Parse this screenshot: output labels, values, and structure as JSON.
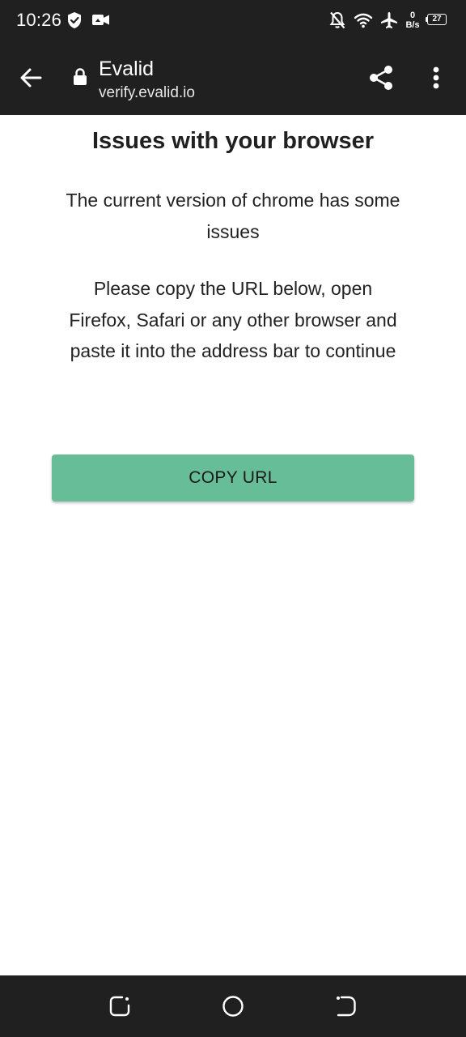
{
  "status_bar": {
    "time": "10:26",
    "net_speed_value": "0",
    "net_speed_unit": "B/s",
    "battery_level": "27",
    "icons": [
      "shield-icon",
      "video-camera-icon",
      "notifications-off-icon",
      "wifi-icon",
      "airplane-icon"
    ]
  },
  "toolbar": {
    "title": "Evalid",
    "url": "verify.evalid.io",
    "icons": [
      "back-arrow-icon",
      "lock-icon",
      "share-icon",
      "more-vert-icon"
    ]
  },
  "page": {
    "heading": "Issues with your browser",
    "paragraph1": "The current version of chrome has some issues",
    "paragraph2": "Please copy the URL below, open Firefox, Safari or any other browser and paste it into the address bar to continue",
    "copy_button_label": "COPY URL"
  },
  "nav_bar": {
    "icons": [
      "recents-icon",
      "home-icon",
      "back-icon"
    ]
  },
  "colors": {
    "chrome_background": "#202020",
    "button_accent": "#66bd97",
    "page_background": "#ffffff"
  }
}
